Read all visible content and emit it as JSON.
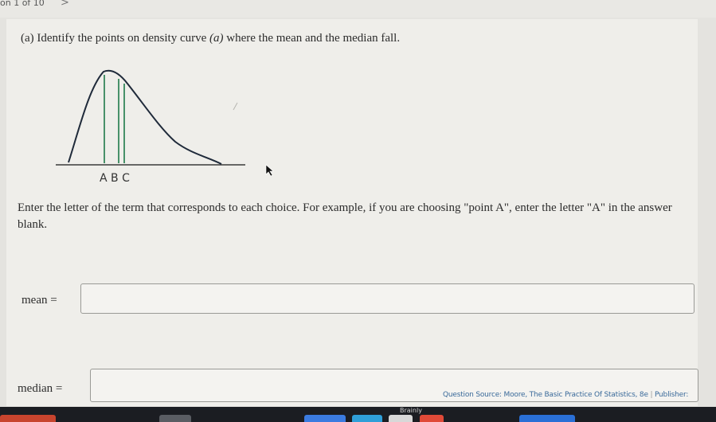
{
  "header": {
    "question_counter": "on 1 of 10",
    "next_arrow": ">"
  },
  "prompt": {
    "lead": "(a) Identify the points on density curve ",
    "var": "(a)",
    "tail": " where the mean and the median fall."
  },
  "graph": {
    "axis_labels": "A B C"
  },
  "instructions": "Enter the letter of the term that corresponds to each choice. For example, if you are choosing \"point A\", enter the letter \"A\" in the answer blank.",
  "fields": {
    "mean": {
      "label": "mean =",
      "value": ""
    },
    "median": {
      "label": "median =",
      "value": ""
    }
  },
  "footer": {
    "source": "Question Source: Moore, The Basic Practice Of Statistics, 8e",
    "separator": "|",
    "publisher": "Publisher:"
  },
  "bottom_bar": {
    "brand": "Brainly"
  },
  "colors": {
    "curve": "#1f2a3a",
    "marker_lines": "#1f7a4a",
    "axis": "#3a3a3a",
    "link": "#3a6a9a"
  }
}
